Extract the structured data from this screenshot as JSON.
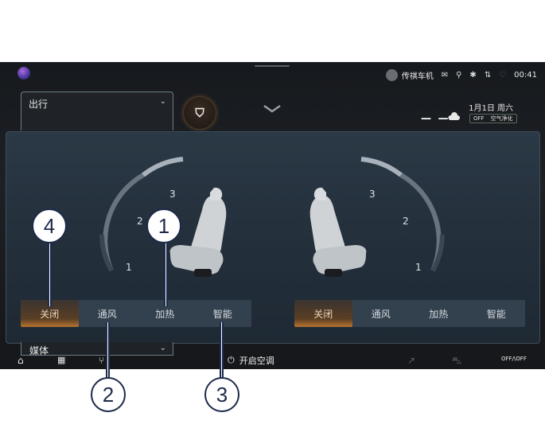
{
  "status_bar": {
    "user": "传祺车机",
    "time": "00:41",
    "icons": [
      "mail-icon",
      "signal-icon",
      "bluetooth-icon",
      "network-icon",
      "heart-icon"
    ]
  },
  "weather": {
    "date": "1月1日 周六",
    "temp": "— —",
    "off": "OFF",
    "air_purify": "空气净化"
  },
  "destination": {
    "label": "出行"
  },
  "media": {
    "label": "媒体"
  },
  "seats": {
    "left": {
      "levels": [
        "1",
        "2",
        "3"
      ],
      "modes": [
        "关闭",
        "通风",
        "加热",
        "智能"
      ],
      "active": "关闭"
    },
    "right": {
      "levels": [
        "3",
        "2",
        "1"
      ],
      "modes": [
        "关闭",
        "通风",
        "加热",
        "智能"
      ],
      "active": "关闭"
    }
  },
  "bottom_bar": {
    "ac_label": "开启空调",
    "offoff": "OFF/\\OFF"
  },
  "callouts": [
    "1",
    "2",
    "3",
    "4"
  ],
  "colors": {
    "accent": "#b5742f",
    "panel": "#2b3946",
    "callout": "#1d2a4a"
  }
}
